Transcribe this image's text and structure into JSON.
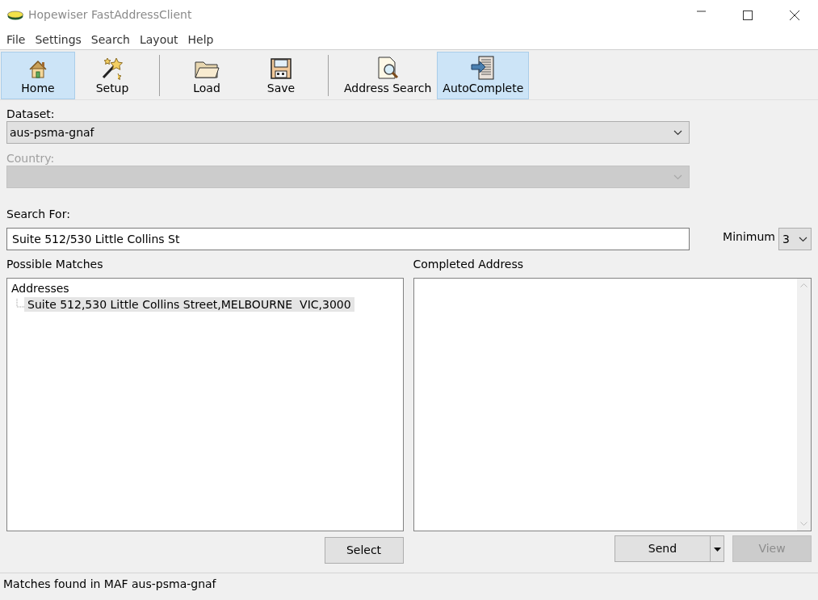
{
  "window": {
    "title": "Hopewiser FastAddressClient"
  },
  "menu": [
    "File",
    "Settings",
    "Search",
    "Layout",
    "Help"
  ],
  "toolbar": [
    {
      "kind": "button",
      "label": "Home",
      "selected": true
    },
    {
      "kind": "button",
      "label": "Setup",
      "selected": false
    },
    {
      "kind": "separator"
    },
    {
      "kind": "button",
      "label": "Load",
      "selected": false
    },
    {
      "kind": "button",
      "label": "Save",
      "selected": false
    },
    {
      "kind": "separator"
    },
    {
      "kind": "button",
      "label": "Address Search",
      "selected": false
    },
    {
      "kind": "button",
      "label": "AutoComplete",
      "selected": true
    }
  ],
  "dataset": {
    "label": "Dataset:",
    "value": "aus-psma-gnaf",
    "disabled": false
  },
  "country": {
    "label": "Country:",
    "disabled": true
  },
  "search": {
    "label": "Search For:",
    "value": "Suite 512/530 Little Collins St"
  },
  "minimum": {
    "label": "Minimum",
    "value": "3"
  },
  "matches": {
    "label": "Possible Matches",
    "tree": [
      {
        "label": "Addresses",
        "children": [
          {
            "label": "Suite 512,530 Little Collins Street,MELBOURNE  VIC,3000",
            "selected": true
          }
        ]
      }
    ]
  },
  "completed": {
    "label": "Completed Address"
  },
  "buttons": {
    "select": {
      "label": "Select",
      "disabled": false
    },
    "send": {
      "label": "Send",
      "disabled": false
    },
    "view": {
      "label": "View",
      "disabled": true
    }
  },
  "status_bar": "Matches found in MAF aus-psma-gnaf"
}
